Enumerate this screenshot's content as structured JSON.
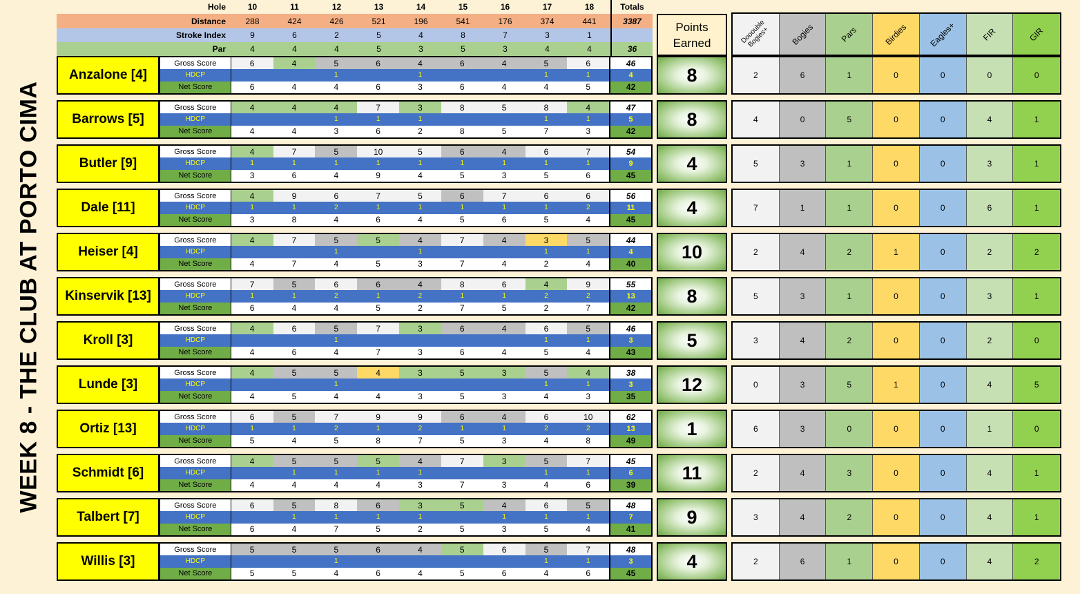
{
  "title": "WEEK 8 - THE CLUB AT PORTO CIMA",
  "header": {
    "hole_label": "Hole",
    "holes": [
      "10",
      "11",
      "12",
      "13",
      "14",
      "15",
      "16",
      "17",
      "18"
    ],
    "totals_label": "Totals",
    "distance_label": "Distance",
    "distances": [
      "288",
      "424",
      "426",
      "521",
      "196",
      "541",
      "176",
      "374",
      "441"
    ],
    "distance_total": "3387",
    "si_label": "Stroke Index",
    "stroke_index": [
      "9",
      "6",
      "2",
      "5",
      "4",
      "8",
      "7",
      "3",
      "1"
    ],
    "par_label": "Par",
    "pars": [
      "4",
      "4",
      "4",
      "5",
      "3",
      "5",
      "3",
      "4",
      "4"
    ],
    "par_total": "36"
  },
  "row_labels": {
    "gross": "Gross Score",
    "hdcp": "HDCP",
    "net": "Net Score"
  },
  "points_header": {
    "line1": "Points",
    "line2": "Earned"
  },
  "stats_header": {
    "double_line1": "Dooouble",
    "double_line2": "Bogies+",
    "bogies": "Bogies",
    "pars": "Pars",
    "birdies": "Birdies",
    "eagles": "Eagles+",
    "fir": "FIR",
    "gir": "GIR"
  },
  "colors": {
    "double": "#f2f2f2",
    "bogey": "#c0c0c0",
    "par": "#a9d08e",
    "birdie": "#ffd966",
    "eagle": "#9bc2e6",
    "name_bg": "#ffff00",
    "hdcp_bg": "#4472c4"
  },
  "players": [
    {
      "name": "Anzalone [4]",
      "gross": [
        "6",
        "4",
        "5",
        "6",
        "4",
        "6",
        "4",
        "5",
        "6"
      ],
      "gross_total": "46",
      "hdcp": [
        "",
        "",
        "1",
        "",
        "1",
        "",
        "",
        "1",
        "1"
      ],
      "hdcp_total": "4",
      "net": [
        "6",
        "4",
        "4",
        "6",
        "3",
        "6",
        "4",
        "4",
        "5"
      ],
      "net_total": "42",
      "points": "8",
      "stats": [
        "2",
        "6",
        "1",
        "0",
        "0",
        "0",
        "0"
      ]
    },
    {
      "name": "Barrows [5]",
      "gross": [
        "4",
        "4",
        "4",
        "7",
        "3",
        "8",
        "5",
        "8",
        "4"
      ],
      "gross_total": "47",
      "hdcp": [
        "",
        "",
        "1",
        "1",
        "1",
        "",
        "",
        "1",
        "1"
      ],
      "hdcp_total": "5",
      "net": [
        "4",
        "4",
        "3",
        "6",
        "2",
        "8",
        "5",
        "7",
        "3"
      ],
      "net_total": "42",
      "points": "8",
      "stats": [
        "4",
        "0",
        "5",
        "0",
        "0",
        "4",
        "1"
      ]
    },
    {
      "name": "Butler [9]",
      "gross": [
        "4",
        "7",
        "5",
        "10",
        "5",
        "6",
        "4",
        "6",
        "7"
      ],
      "gross_total": "54",
      "hdcp": [
        "1",
        "1",
        "1",
        "1",
        "1",
        "1",
        "1",
        "1",
        "1"
      ],
      "hdcp_total": "9",
      "net": [
        "3",
        "6",
        "4",
        "9",
        "4",
        "5",
        "3",
        "5",
        "6"
      ],
      "net_total": "45",
      "points": "4",
      "stats": [
        "5",
        "3",
        "1",
        "0",
        "0",
        "3",
        "1"
      ]
    },
    {
      "name": "Dale [11]",
      "gross": [
        "4",
        "9",
        "6",
        "7",
        "5",
        "6",
        "7",
        "6",
        "6"
      ],
      "gross_total": "56",
      "hdcp": [
        "1",
        "1",
        "2",
        "1",
        "1",
        "1",
        "1",
        "1",
        "2"
      ],
      "hdcp_total": "11",
      "net": [
        "3",
        "8",
        "4",
        "6",
        "4",
        "5",
        "6",
        "5",
        "4"
      ],
      "net_total": "45",
      "points": "4",
      "stats": [
        "7",
        "1",
        "1",
        "0",
        "0",
        "6",
        "1"
      ]
    },
    {
      "name": "Heiser [4]",
      "gross": [
        "4",
        "7",
        "5",
        "5",
        "4",
        "7",
        "4",
        "3",
        "5"
      ],
      "gross_total": "44",
      "hdcp": [
        "",
        "",
        "1",
        "",
        "1",
        "",
        "",
        "1",
        "1"
      ],
      "hdcp_total": "4",
      "net": [
        "4",
        "7",
        "4",
        "5",
        "3",
        "7",
        "4",
        "2",
        "4"
      ],
      "net_total": "40",
      "points": "10",
      "stats": [
        "2",
        "4",
        "2",
        "1",
        "0",
        "2",
        "2"
      ]
    },
    {
      "name": "Kinservik [13]",
      "gross": [
        "7",
        "5",
        "6",
        "6",
        "4",
        "8",
        "6",
        "4",
        "9"
      ],
      "gross_total": "55",
      "hdcp": [
        "1",
        "1",
        "2",
        "1",
        "2",
        "1",
        "1",
        "2",
        "2"
      ],
      "hdcp_total": "13",
      "net": [
        "6",
        "4",
        "4",
        "5",
        "2",
        "7",
        "5",
        "2",
        "7"
      ],
      "net_total": "42",
      "points": "8",
      "stats": [
        "5",
        "3",
        "1",
        "0",
        "0",
        "3",
        "1"
      ]
    },
    {
      "name": "Kroll [3]",
      "gross": [
        "4",
        "6",
        "5",
        "7",
        "3",
        "6",
        "4",
        "6",
        "5"
      ],
      "gross_total": "46",
      "hdcp": [
        "",
        "",
        "1",
        "",
        "",
        "",
        "",
        "1",
        "1"
      ],
      "hdcp_total": "3",
      "net": [
        "4",
        "6",
        "4",
        "7",
        "3",
        "6",
        "4",
        "5",
        "4"
      ],
      "net_total": "43",
      "points": "5",
      "stats": [
        "3",
        "4",
        "2",
        "0",
        "0",
        "2",
        "0"
      ]
    },
    {
      "name": "Lunde [3]",
      "gross": [
        "4",
        "5",
        "5",
        "4",
        "3",
        "5",
        "3",
        "5",
        "4"
      ],
      "gross_total": "38",
      "hdcp": [
        "",
        "",
        "1",
        "",
        "",
        "",
        "",
        "1",
        "1"
      ],
      "hdcp_total": "3",
      "net": [
        "4",
        "5",
        "4",
        "4",
        "3",
        "5",
        "3",
        "4",
        "3"
      ],
      "net_total": "35",
      "points": "12",
      "stats": [
        "0",
        "3",
        "5",
        "1",
        "0",
        "4",
        "5"
      ]
    },
    {
      "name": "Ortiz [13]",
      "gross": [
        "6",
        "5",
        "7",
        "9",
        "9",
        "6",
        "4",
        "6",
        "10"
      ],
      "gross_total": "62",
      "hdcp": [
        "1",
        "1",
        "2",
        "1",
        "2",
        "1",
        "1",
        "2",
        "2"
      ],
      "hdcp_total": "13",
      "net": [
        "5",
        "4",
        "5",
        "8",
        "7",
        "5",
        "3",
        "4",
        "8"
      ],
      "net_total": "49",
      "points": "1",
      "stats": [
        "6",
        "3",
        "0",
        "0",
        "0",
        "1",
        "0"
      ]
    },
    {
      "name": "Schmidt [6]",
      "gross": [
        "4",
        "5",
        "5",
        "5",
        "4",
        "7",
        "3",
        "5",
        "7"
      ],
      "gross_total": "45",
      "hdcp": [
        "",
        "1",
        "1",
        "1",
        "1",
        "",
        "",
        "1",
        "1"
      ],
      "hdcp_total": "6",
      "net": [
        "4",
        "4",
        "4",
        "4",
        "3",
        "7",
        "3",
        "4",
        "6"
      ],
      "net_total": "39",
      "points": "11",
      "stats": [
        "2",
        "4",
        "3",
        "0",
        "0",
        "4",
        "1"
      ]
    },
    {
      "name": "Talbert [7]",
      "gross": [
        "6",
        "5",
        "8",
        "6",
        "3",
        "5",
        "4",
        "6",
        "5"
      ],
      "gross_total": "48",
      "hdcp": [
        "",
        "1",
        "1",
        "1",
        "1",
        "",
        "1",
        "1",
        "1"
      ],
      "hdcp_total": "7",
      "net": [
        "6",
        "4",
        "7",
        "5",
        "2",
        "5",
        "3",
        "5",
        "4"
      ],
      "net_total": "41",
      "points": "9",
      "stats": [
        "3",
        "4",
        "2",
        "0",
        "0",
        "4",
        "1"
      ]
    },
    {
      "name": "Willis [3]",
      "gross": [
        "5",
        "5",
        "5",
        "6",
        "4",
        "5",
        "6",
        "5",
        "7"
      ],
      "gross_total": "48",
      "hdcp": [
        "",
        "",
        "1",
        "",
        "",
        "",
        "",
        "1",
        "1"
      ],
      "hdcp_total": "3",
      "net": [
        "5",
        "5",
        "4",
        "6",
        "4",
        "5",
        "6",
        "4",
        "6"
      ],
      "net_total": "45",
      "points": "4",
      "stats": [
        "2",
        "6",
        "1",
        "0",
        "0",
        "4",
        "2"
      ]
    }
  ]
}
